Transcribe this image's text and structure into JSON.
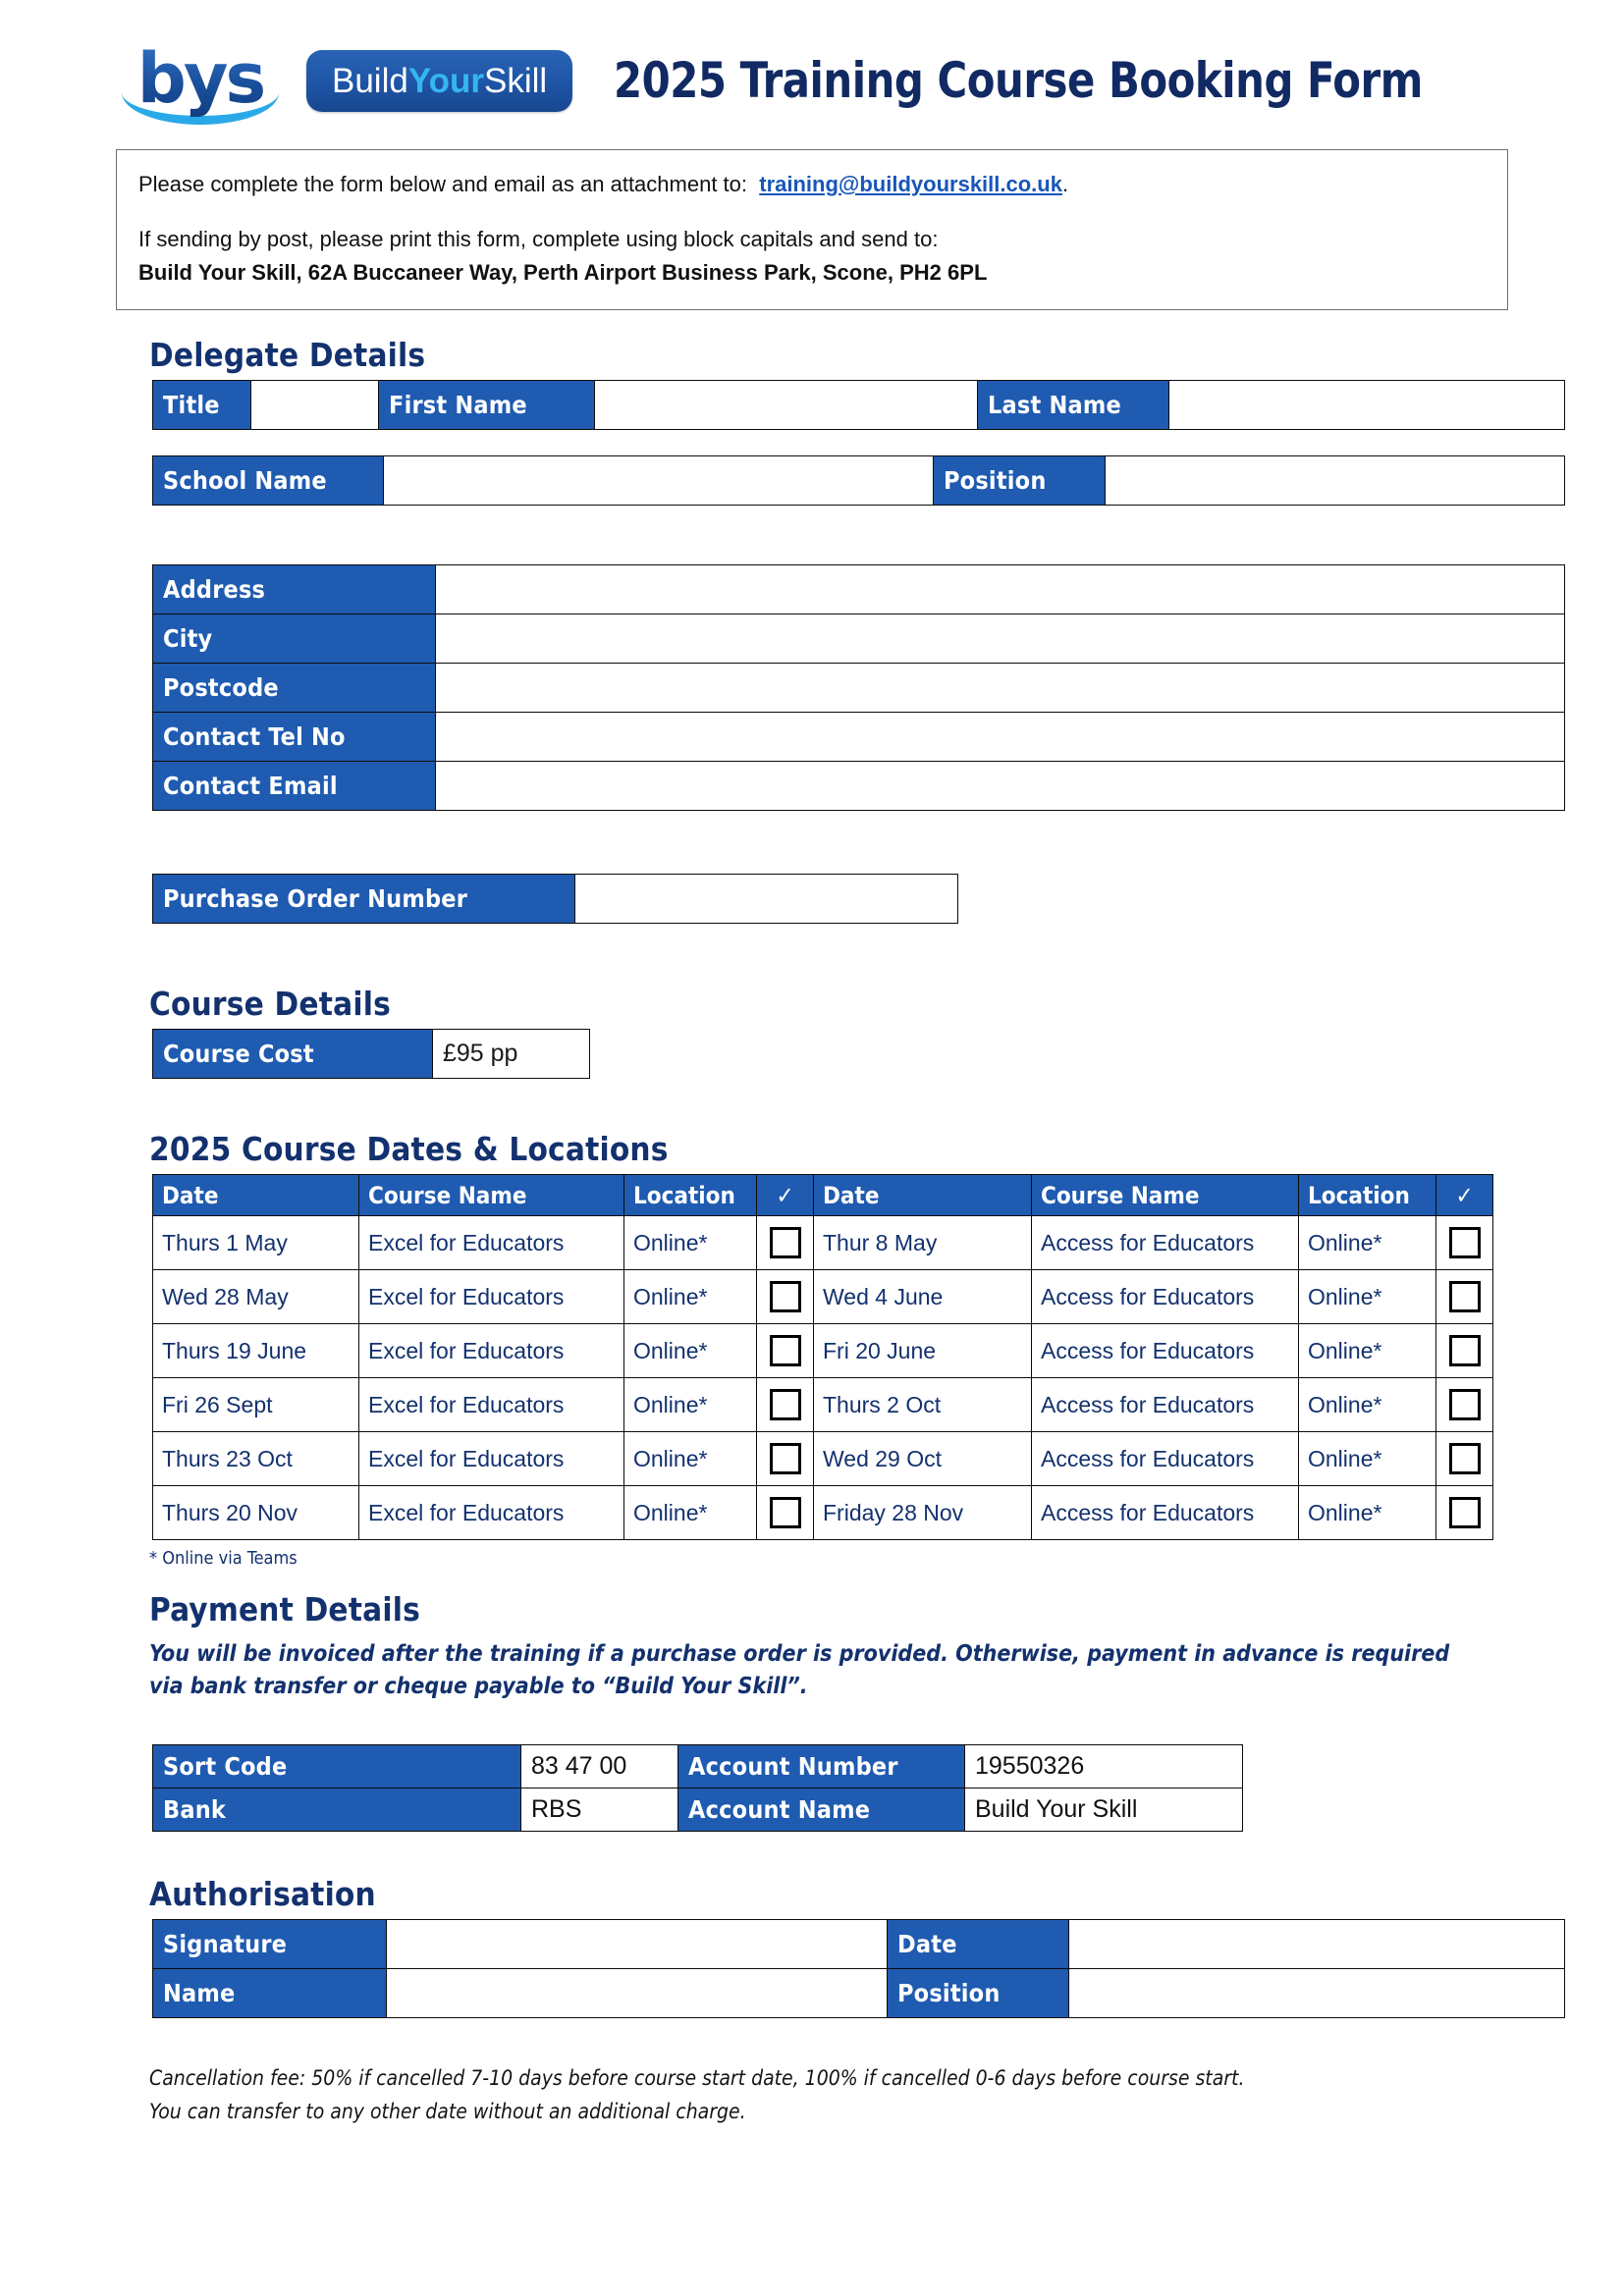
{
  "brand": {
    "logo_mark": "bys",
    "badge_build": "Build",
    "badge_your": "Your",
    "badge_skill": "Skill",
    "accent_blue": "#1F5BB0",
    "accent_cyan": "#35B6F0",
    "heading_navy": "#13316E"
  },
  "header": {
    "title": "2025 Training Course Booking Form"
  },
  "instructions": {
    "line1_prefix": "Please complete the form below and email as an attachment to:",
    "email": "training@buildyourskill.co.uk",
    "line1_suffix": ".",
    "line2": "If sending by post, please print this form, complete using block capitals and send to:",
    "address": "Build Your Skill, 62A Buccaneer Way, Perth Airport Business Park, Scone, PH2 6PL"
  },
  "delegate": {
    "heading": "Delegate Details",
    "title_label": "Title",
    "title_value": "",
    "first_name_label": "First Name",
    "first_name_value": "",
    "last_name_label": "Last Name",
    "last_name_value": "",
    "school_label": "School Name",
    "school_value": "",
    "position_label": "Position",
    "position_value": "",
    "address_label": "Address",
    "address_value": "",
    "city_label": "City",
    "city_value": "",
    "postcode_label": "Postcode",
    "postcode_value": "",
    "tel_label": "Contact Tel No",
    "tel_value": "",
    "email_label": "Contact Email",
    "email_value": "",
    "po_label": "Purchase Order Number",
    "po_value": ""
  },
  "course_details": {
    "heading": "Course Details",
    "cost_label": "Course Cost",
    "cost_value": "£95 pp"
  },
  "course_dates": {
    "heading": "2025 Course Dates & Locations",
    "columns": [
      "Date",
      "Course Name",
      "Location",
      "✓",
      "Date",
      "Course Name",
      "Location",
      "✓"
    ],
    "check_symbol": "✓",
    "rows": [
      {
        "left_date": "Thurs 1 May",
        "left_course": "Excel for Educators",
        "left_location": "Online*",
        "left_checked": false,
        "right_date": "Thur 8 May",
        "right_course": "Access for Educators",
        "right_location": "Online*",
        "right_checked": false
      },
      {
        "left_date": "Wed 28 May",
        "left_course": "Excel for Educators",
        "left_location": "Online*",
        "left_checked": false,
        "right_date": "Wed 4 June",
        "right_course": "Access for Educators",
        "right_location": "Online*",
        "right_checked": false
      },
      {
        "left_date": "Thurs 19 June",
        "left_course": "Excel for Educators",
        "left_location": "Online*",
        "left_checked": false,
        "right_date": "Fri 20 June",
        "right_course": "Access for Educators",
        "right_location": "Online*",
        "right_checked": false
      },
      {
        "left_date": "Fri 26 Sept",
        "left_course": "Excel for Educators",
        "left_location": "Online*",
        "left_checked": false,
        "right_date": "Thurs 2 Oct",
        "right_course": "Access for Educators",
        "right_location": "Online*",
        "right_checked": false
      },
      {
        "left_date": "Thurs 23 Oct",
        "left_course": "Excel for Educators",
        "left_location": "Online*",
        "left_checked": false,
        "right_date": "Wed 29 Oct",
        "right_course": "Access for Educators",
        "right_location": "Online*",
        "right_checked": false
      },
      {
        "left_date": "Thurs 20 Nov",
        "left_course": "Excel for Educators",
        "left_location": "Online*",
        "left_checked": false,
        "right_date": "Friday 28 Nov",
        "right_course": "Access for Educators",
        "right_location": "Online*",
        "right_checked": false
      }
    ],
    "footnote": "* Online via Teams"
  },
  "payment": {
    "heading": "Payment Details",
    "note": "You will be invoiced after the training if a purchase order is provided. Otherwise, payment in advance is required via bank transfer or cheque payable to “Build Your Skill”.",
    "sort_code_label": "Sort Code",
    "sort_code_value": "83 47 00",
    "account_number_label": "Account Number",
    "account_number_value": "19550326",
    "bank_label": "Bank",
    "bank_value": "RBS",
    "account_name_label": "Account Name",
    "account_name_value": "Build Your Skill"
  },
  "authorisation": {
    "heading": "Authorisation",
    "signature_label": "Signature",
    "signature_value": "",
    "date_label": "Date",
    "date_value": "",
    "name_label": "Name",
    "name_value": "",
    "position_label": "Position",
    "position_value": ""
  },
  "footer": {
    "line1": "Cancellation fee: 50% if cancelled 7-10 days before course start date, 100% if cancelled 0-6 days before course start.",
    "line2": "You can transfer to any other date without an additional charge."
  }
}
